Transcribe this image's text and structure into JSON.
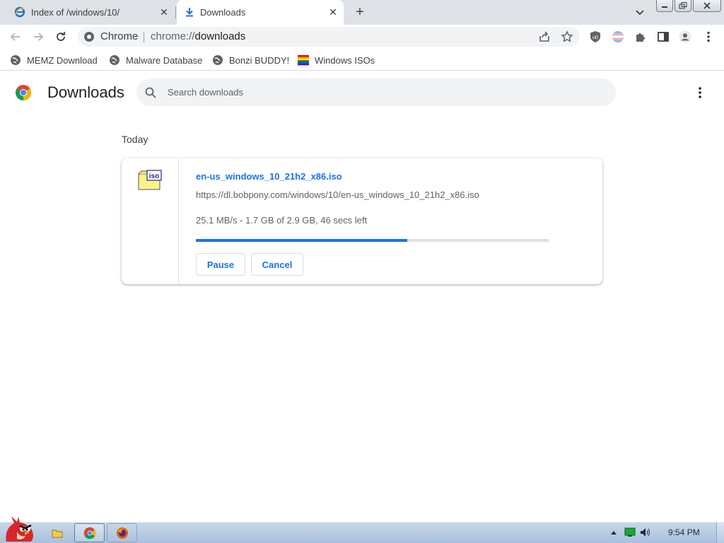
{
  "tabs": [
    {
      "title": "Index of /windows/10/",
      "icon": "internet-explorer-icon",
      "active": false
    },
    {
      "title": "Downloads",
      "icon": "download-icon",
      "active": true
    }
  ],
  "toolbar": {
    "site_name": "Chrome",
    "url_scheme": "chrome://",
    "url_host": "downloads"
  },
  "bookmarks": [
    {
      "label": "MEMZ Download",
      "icon": "globe-icon"
    },
    {
      "label": "Malware Database",
      "icon": "globe-icon"
    },
    {
      "label": "Bonzi BUDDY!",
      "icon": "globe-icon"
    },
    {
      "label": "Windows ISOs",
      "icon": "rainbow-flag-icon"
    }
  ],
  "downloads_page": {
    "title": "Downloads",
    "search_placeholder": "Search downloads",
    "section": "Today",
    "item": {
      "file_name": "en-us_windows_10_21h2_x86.iso",
      "url": "https://dl.bobpony.com/windows/10/en-us_windows_10_21h2_x86.iso",
      "status": "25.1 MB/s - 1.7 GB of 2.9 GB, 46 secs left",
      "progress": 0.6,
      "pause_label": "Pause",
      "cancel_label": "Cancel"
    }
  },
  "taskbar": {
    "clock": "9:54 PM"
  },
  "colors": {
    "accent": "#1a73e8",
    "tabstrip": "#dee1e6"
  }
}
